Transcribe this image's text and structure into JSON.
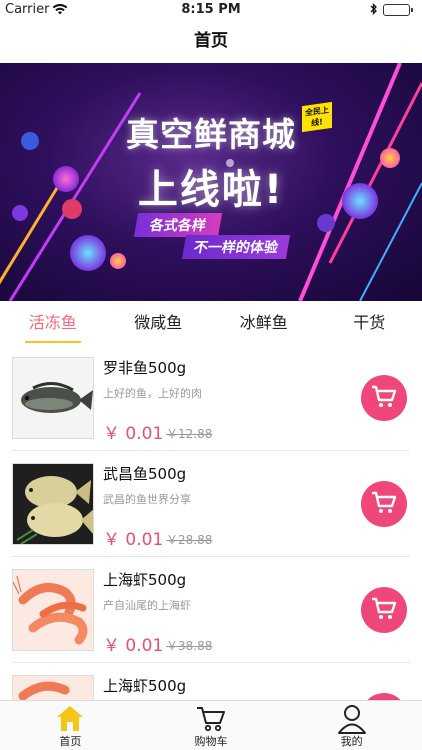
{
  "status_bar": {
    "carrier": "Carrier",
    "time": "8:15 PM"
  },
  "navbar": {
    "title": "首页"
  },
  "banner": {
    "title_line1": "真空鲜商城",
    "title_line2": "上线啦!",
    "badge": "全民上线!",
    "tag1": "各式各样",
    "tag2": "不一样的体验"
  },
  "tabs": [
    {
      "label": "活冻鱼",
      "active": true
    },
    {
      "label": "微咸鱼",
      "active": false
    },
    {
      "label": "冰鲜鱼",
      "active": false
    },
    {
      "label": "干货",
      "active": false
    }
  ],
  "products": [
    {
      "name": "罗非鱼500g",
      "desc": "上好的鱼，上好的肉",
      "price": "￥ 0.01",
      "old_price": "￥12.88",
      "image": "tilapia-image"
    },
    {
      "name": "武昌鱼500g",
      "desc": "武昌的鱼世界分享",
      "price": "￥ 0.01",
      "old_price": "￥28.88",
      "image": "pomfret-image"
    },
    {
      "name": "上海虾500g",
      "desc": "产自汕尾的上海虾",
      "price": "￥ 0.01",
      "old_price": "￥38.88",
      "image": "shrimp-image"
    },
    {
      "name": "上海虾500g",
      "desc": "",
      "price": "",
      "old_price": "",
      "image": "shrimp-image"
    }
  ],
  "tabbar": [
    {
      "label": "首页",
      "icon": "home-icon"
    },
    {
      "label": "购物车",
      "icon": "cart-icon"
    },
    {
      "label": "我的",
      "icon": "user-icon"
    }
  ],
  "colors": {
    "accent": "#f0477a",
    "active_tab": "#f26b7c",
    "price": "#ea4f73",
    "underline": "#f5c518",
    "home_icon": "#f5c518"
  }
}
